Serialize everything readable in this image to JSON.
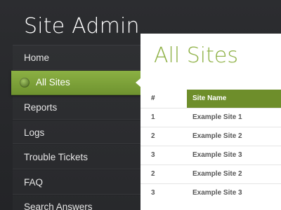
{
  "app": {
    "title": "Site Admin"
  },
  "sidebar": {
    "items": [
      {
        "label": "Home"
      },
      {
        "label": "All Sites",
        "active": true,
        "icon": "globe-icon"
      },
      {
        "label": "Reports"
      },
      {
        "label": "Logs"
      },
      {
        "label": "Trouble Tickets"
      },
      {
        "label": "FAQ"
      },
      {
        "label": "Search Answers"
      }
    ]
  },
  "main": {
    "title": "All Sites",
    "table": {
      "headers": [
        "#",
        "Site Name"
      ],
      "rows": [
        {
          "num": "1",
          "name": "Example Site 1"
        },
        {
          "num": "2",
          "name": "Example Site 2"
        },
        {
          "num": "3",
          "name": "Example Site 3"
        },
        {
          "num": "2",
          "name": "Example Site 2"
        },
        {
          "num": "3",
          "name": "Example Site 3"
        }
      ]
    }
  },
  "colors": {
    "accent": "#7fa33a",
    "header_green": "#6e8e2b",
    "title_green": "#8db043",
    "sidebar_bg": "#2c2d30"
  }
}
